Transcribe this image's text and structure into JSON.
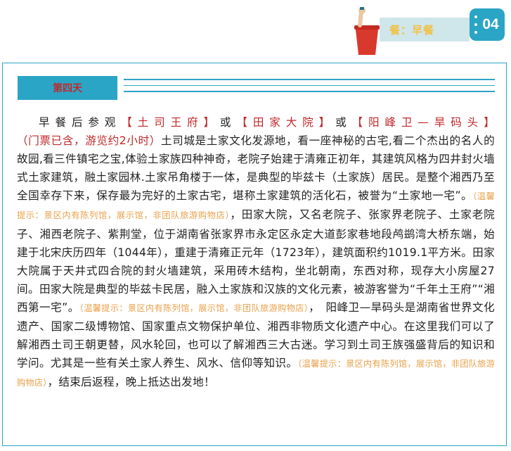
{
  "header": {
    "meal_label": "餐：早餐",
    "day_number": "04",
    "colors": {
      "accent": "#2aa5c6",
      "badge_bg": "#cfe6ea",
      "meal_text": "#f0c24a",
      "cup": "#d9382d"
    },
    "icons": [
      "cup-icon",
      "badge-dots-icon"
    ]
  },
  "section": {
    "title": "第四天"
  },
  "content": {
    "p1_lead": "早餐后参观",
    "hl_1": "【土司王府】",
    "or_1": "或",
    "hl_2": "【田家大院】",
    "or_2": "或",
    "hl_3": "【阳峰卫—旱码头】",
    "ticket_note": "（门票已含，游览约2小时）",
    "p1_body": "土司城是土家文化发源地，看一座神秘的古宅,看二个杰出的名人的故园,看三件镇宅之宝,体验土家族四种神奇，老院子始建于清雍正初年，其建筑风格为四井封火墙式土家建筑，融土家园林.土家吊角楼于一体，是典型的毕兹卡（土家族）居民。是整个湘西乃至全国幸存下来，保存最为完好的土家古宅，堪称土家建筑的活化石，被誉为“土家地一宅”。",
    "tip_1": "（温馨提示：景区内有陈列馆，展示馆，非团队旅游购物店）",
    "p2_body": "，田家大院，又名老院子、张家界老院子、土家老院子、湘西老院子、紫荆堂，位于湖南省张家界市永定区永定大道彭家巷地段鸬鹚湾大桥东端，始建于北宋庆历四年（1044年），重建于清雍正元年（1723年），建筑面积约1019.1平方米。田家大院属于天井式四合院的封火墙建筑，采用砖木结构，坐北朝南，东西对称，现存大小房屋27间。田家大院是典型的毕兹卡民居，融入土家族和汉族的文化元素，被游客誉为“千年土王府”“湘西第一宅”。",
    "tip_2": "（温馨提示：景区内有陈列馆，展示馆，非团队旅游购物店）",
    "p3_body": "，　阳峰卫—旱码头是湖南省世界文化遗产、国家二级博物馆、国家重点文物保护单位、湘西非物质文化遗产中心。在这里我们可以了解湘西土司王朝更替，风水轮回，也可以了解湘西三大古迷。学习到土司王族强盛背后的知识和学问。尤其是一些有关土家人养生、风水、信仰等知识。",
    "tip_3": "（温馨提示：景区内有陈列馆，展示馆，非团队旅游购物店）",
    "p4_body": "，结束后返程，晚上抵达出发地！"
  }
}
